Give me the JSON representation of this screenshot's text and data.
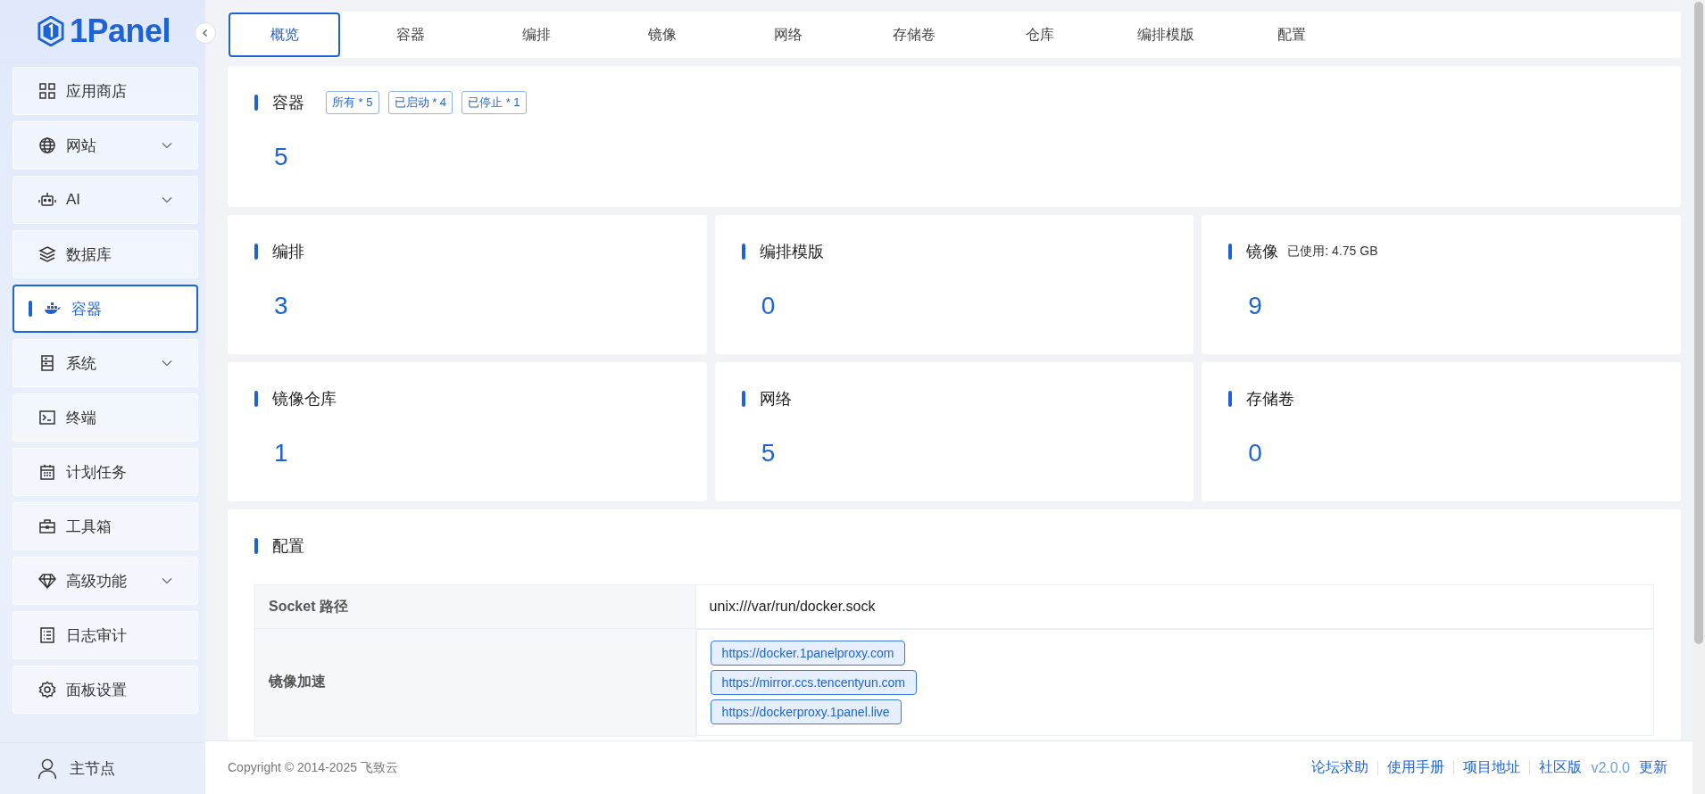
{
  "sidebar": {
    "logo": "1Panel",
    "items": [
      {
        "label": "应用商店",
        "has_submenu": false,
        "selected": false
      },
      {
        "label": "网站",
        "has_submenu": true,
        "selected": false
      },
      {
        "label": "AI",
        "has_submenu": true,
        "selected": false
      },
      {
        "label": "数据库",
        "has_submenu": false,
        "selected": false
      },
      {
        "label": "容器",
        "has_submenu": false,
        "selected": true
      },
      {
        "label": "系统",
        "has_submenu": true,
        "selected": false
      },
      {
        "label": "终端",
        "has_submenu": false,
        "selected": false
      },
      {
        "label": "计划任务",
        "has_submenu": false,
        "selected": false
      },
      {
        "label": "工具箱",
        "has_submenu": false,
        "selected": false
      },
      {
        "label": "高级功能",
        "has_submenu": true,
        "selected": false
      },
      {
        "label": "日志审计",
        "has_submenu": false,
        "selected": false
      },
      {
        "label": "面板设置",
        "has_submenu": false,
        "selected": false
      }
    ],
    "node": "主节点"
  },
  "tabs": [
    {
      "label": "概览",
      "selected": true
    },
    {
      "label": "容器",
      "selected": false
    },
    {
      "label": "编排",
      "selected": false
    },
    {
      "label": "镜像",
      "selected": false
    },
    {
      "label": "网络",
      "selected": false
    },
    {
      "label": "存储卷",
      "selected": false
    },
    {
      "label": "仓库",
      "selected": false
    },
    {
      "label": "编排模版",
      "selected": false
    },
    {
      "label": "配置",
      "selected": false
    }
  ],
  "containers": {
    "title": "容器",
    "tags": [
      "所有 * 5",
      "已启动 * 4",
      "已停止 * 1"
    ],
    "count": "5"
  },
  "stats": [
    {
      "title": "编排",
      "count": "3"
    },
    {
      "title": "编排模版",
      "count": "0"
    },
    {
      "title": "镜像",
      "note": "已使用: 4.75 GB",
      "count": "9"
    },
    {
      "title": "镜像仓库",
      "count": "1"
    },
    {
      "title": "网络",
      "count": "5"
    },
    {
      "title": "存储卷",
      "count": "0"
    }
  ],
  "config": {
    "title": "配置",
    "rows": [
      {
        "label": "Socket 路径",
        "kind": "text",
        "value": "unix:///var/run/docker.sock"
      },
      {
        "label": "镜像加速",
        "kind": "tags",
        "values": [
          "https://docker.1panelproxy.com",
          "https://mirror.ccs.tencentyun.com",
          "https://dockerproxy.1panel.live"
        ]
      }
    ]
  },
  "footer": {
    "copyright": "Copyright © 2014-2025 飞致云",
    "links": [
      "论坛求助",
      "使用手册",
      "项目地址"
    ],
    "edition": "社区版",
    "version": "v2.0.0",
    "update": "更新"
  }
}
